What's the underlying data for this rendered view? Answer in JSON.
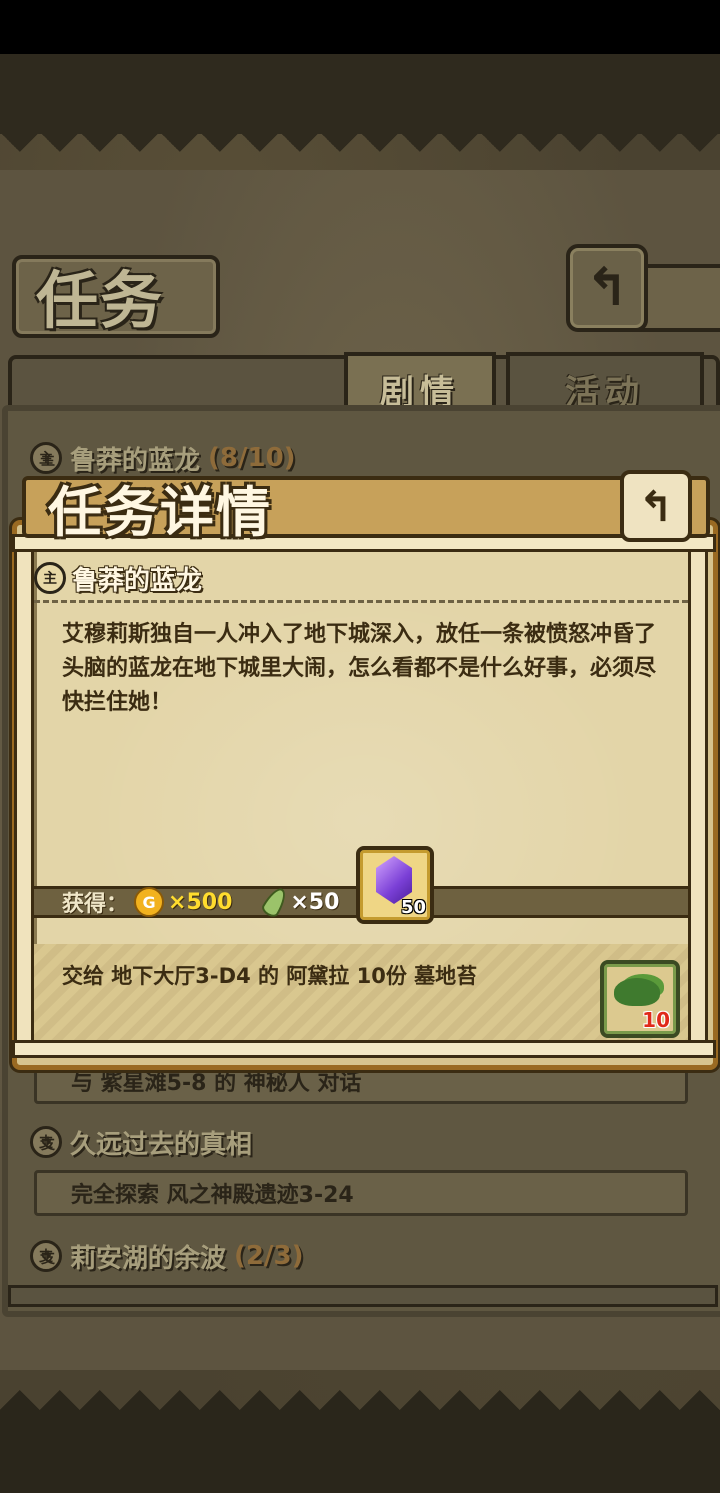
{
  "header": {
    "title": "任务",
    "back_icon": "back-arrow-icon"
  },
  "tabs": [
    {
      "label": "剧情",
      "active": true
    },
    {
      "label": "活动",
      "active": false
    }
  ],
  "quests": [
    {
      "name": "鲁莽的蓝龙",
      "progress": "(8/10)",
      "icon": "quest-seal-icon"
    },
    {
      "objective": "与 紫星滩5-8 的 神秘人 对话"
    },
    {
      "name": "久远过去的真相",
      "progress": "",
      "icon": "quest-seal-icon"
    },
    {
      "objective": "完全探索 风之神殿遗迹3-24"
    },
    {
      "name": "莉安湖的余波",
      "progress": "(2/3)",
      "icon": "quest-seal-icon"
    }
  ],
  "modal": {
    "title": "任务详情",
    "quest_name": "鲁莽的蓝龙",
    "description": "艾穆莉斯独自一人冲入了地下城深入，放任一条被愤怒冲昏了头脑的蓝龙在地下城里大闹，怎么看都不是什么好事，必须尽快拦住她！",
    "reward_label": "获得：",
    "coin_icon_letter": "G",
    "gold": "×500",
    "feather": "×50",
    "gem_qty": "50",
    "objective": "交给 地下大厅3-D4  的 阿黛拉 10份 墓地苔",
    "item_qty": "10"
  },
  "colors": {
    "gold_text": "#ffdc2e",
    "item_qty": "#e02a1a",
    "modal_border": "#9a6a22"
  }
}
